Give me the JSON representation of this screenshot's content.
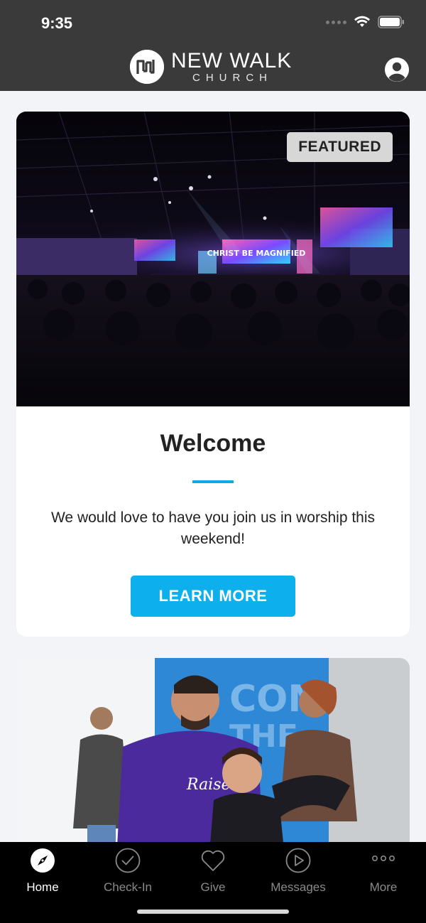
{
  "status_bar": {
    "time": "9:35"
  },
  "header": {
    "logo_title": "NEW WALK",
    "logo_subtitle": "CHURCH"
  },
  "featured_card": {
    "badge": "FEATURED",
    "title": "Welcome",
    "body": "We would love to have you join us in worship this weekend!",
    "button_label": "LEARN MORE",
    "stage_screen_text": "CHRIST BE MAGNIFIED"
  },
  "tabs": [
    {
      "label": "Home",
      "icon": "compass-icon",
      "active": true
    },
    {
      "label": "Check-In",
      "icon": "check-circle-icon",
      "active": false
    },
    {
      "label": "Give",
      "icon": "heart-icon",
      "active": false
    },
    {
      "label": "Messages",
      "icon": "play-circle-icon",
      "active": false
    },
    {
      "label": "More",
      "icon": "more-dots-icon",
      "active": false
    }
  ],
  "colors": {
    "header_bg": "#3a3a3a",
    "accent": "#0db0ec",
    "tabbar_bg": "#000000",
    "page_bg": "#f3f4f8"
  }
}
